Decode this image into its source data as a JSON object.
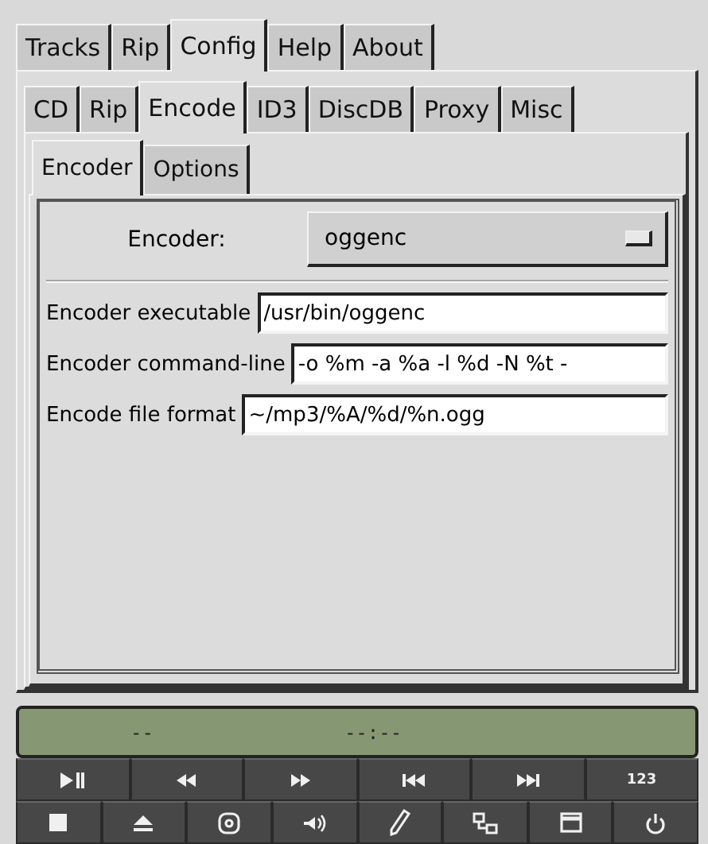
{
  "main_tabs": [
    {
      "label": "Tracks",
      "selected": false
    },
    {
      "label": "Rip",
      "selected": false
    },
    {
      "label": "Config",
      "selected": true
    },
    {
      "label": "Help",
      "selected": false
    },
    {
      "label": "About",
      "selected": false
    }
  ],
  "config_tabs": [
    {
      "label": "CD",
      "selected": false
    },
    {
      "label": "Rip",
      "selected": false
    },
    {
      "label": "Encode",
      "selected": true
    },
    {
      "label": "ID3",
      "selected": false
    },
    {
      "label": "DiscDB",
      "selected": false
    },
    {
      "label": "Proxy",
      "selected": false
    },
    {
      "label": "Misc",
      "selected": false
    }
  ],
  "encode_tabs": [
    {
      "label": "Encoder",
      "selected": true
    },
    {
      "label": "Options",
      "selected": false
    }
  ],
  "encoder": {
    "label": "Encoder:",
    "value": "oggenc"
  },
  "fields": [
    {
      "label": "Encoder executable",
      "value": "/usr/bin/oggenc"
    },
    {
      "label": "Encoder command-line",
      "value": "-o %m -a %a -l %d -N %t -"
    },
    {
      "label": "Encode file format",
      "value": "~/mp3/%A/%d/%n.ogg"
    }
  ],
  "display": {
    "track": "--",
    "time": "--:--"
  },
  "controls_row_1": [
    {
      "kind": "play-pause"
    },
    {
      "kind": "rewind"
    },
    {
      "kind": "forward"
    },
    {
      "kind": "previous"
    },
    {
      "kind": "next"
    },
    {
      "kind": "text",
      "text": "123"
    }
  ],
  "controls_row_2": [
    {
      "kind": "stop"
    },
    {
      "kind": "eject"
    },
    {
      "kind": "disc"
    },
    {
      "kind": "volume"
    },
    {
      "kind": "pencil"
    },
    {
      "kind": "network"
    },
    {
      "kind": "window"
    },
    {
      "kind": "power"
    }
  ]
}
